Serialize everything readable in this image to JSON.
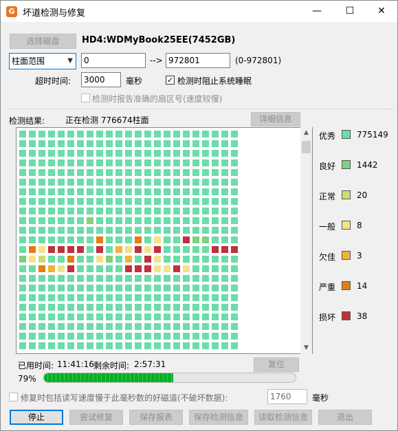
{
  "window": {
    "title": "坏道检测与修复",
    "app_icon_letter": "G",
    "minimize_glyph": "—",
    "maximize_glyph": "☐",
    "close_glyph": "✕"
  },
  "disk": {
    "select_button": "选择磁盘",
    "name": "HD4:WDMyBook25EE(7452GB)"
  },
  "range": {
    "mode": "柱面范围",
    "from": "0",
    "arrow": "-->",
    "to": "972801",
    "hint": "(0-972801)"
  },
  "timeout": {
    "label": "超时时间:",
    "value": "3000",
    "unit": "毫秒"
  },
  "options": {
    "prevent_sleep": "检测时阻止系统睡眠",
    "prevent_sleep_checked": true,
    "report_exact_sector": "检测时报告准确的扇区号(速度较慢)",
    "report_exact_sector_checked": false
  },
  "result": {
    "label": "检测结果:",
    "status": "正在检测 776674柱面",
    "details_button": "详细信息"
  },
  "legend": [
    {
      "label": "优秀",
      "count": "775149",
      "color": "#6ddcaa"
    },
    {
      "label": "良好",
      "count": "1442",
      "color": "#7fd07f"
    },
    {
      "label": "正常",
      "count": "20",
      "color": "#c6df74"
    },
    {
      "label": "一般",
      "count": "8",
      "color": "#f3e28b"
    },
    {
      "label": "欠佳",
      "count": "3",
      "color": "#f0b43a"
    },
    {
      "label": "严重",
      "count": "14",
      "color": "#e07e12"
    },
    {
      "label": "损坏",
      "count": "38",
      "color": "#c0303e"
    }
  ],
  "grid": {
    "columns": 23,
    "rows_total": 23,
    "special_rows": [
      "000000000000000000000000",
      "000000000000000000000000",
      "000000000000000000000000",
      "000000000000000000000000",
      "000000000000000000000000",
      "000000000000000000000000",
      "000000000000000000000000",
      "000000000000000000000000",
      "000000000000000000000000",
      "000000010000000000000000",
      "000000000000000000000000",
      "000000005000503006110000",
      "053666606043636000006665",
      "132005003104063000000001",
      "005436000006663363000000",
      "000000000000000000000000",
      "000000000000000000000000",
      "000000000000000000000000",
      "000000000000000000000000",
      "000000000000000000000000",
      "000000000000000000000000",
      "000000000000000000000000",
      "000000000000000000000000"
    ]
  },
  "timing": {
    "elapsed_label": "已用时间:",
    "elapsed": "11:41:16",
    "remaining_label": "剩余时间:",
    "remaining": "2:57:31",
    "reset_button": "复位"
  },
  "progress": {
    "percent_text": "79%",
    "fraction": 0.79
  },
  "repair": {
    "option_label": "修复时包括读写速度慢于此毫秒数的好磁道(不破坏数据):",
    "option_checked": false,
    "ms_value": "1760",
    "ms_unit": "毫秒"
  },
  "buttons": {
    "stop": "停止",
    "try_repair": "尝试修复",
    "save_report": "保存报表",
    "save_result": "保存检测信息",
    "load_result": "读取检测信息",
    "exit": "退出"
  }
}
